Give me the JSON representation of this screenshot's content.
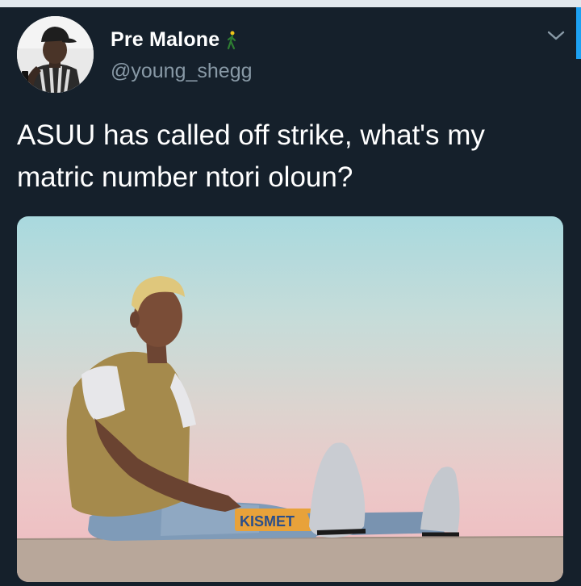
{
  "tweet": {
    "display_name": "Pre Malone",
    "handle": "@young_shegg",
    "text": "ASUU has called off strike, what's my matric number ntori oloun?",
    "name_emoji": "walking-person-icon",
    "menu_icon": "chevron-down-icon"
  },
  "colors": {
    "background": "#15202b",
    "secondary_text": "#8899a6",
    "accent": "#1da1f2"
  }
}
